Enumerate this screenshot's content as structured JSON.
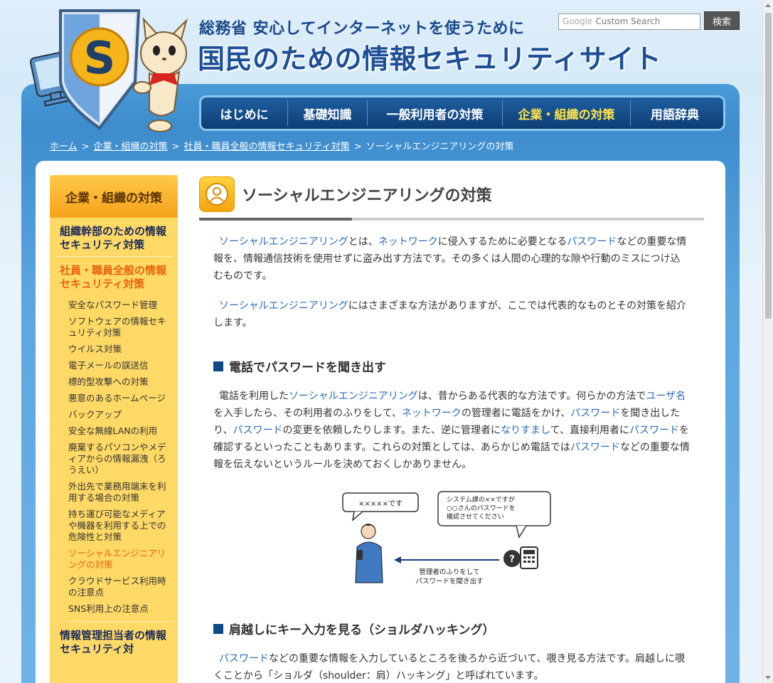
{
  "header": {
    "subtitle": "総務省 安心してインターネットを使うために",
    "title": "国民のための情報セキュリティサイト"
  },
  "search": {
    "brand": "Google",
    "placeholder": "Custom Search",
    "button_label": "検索"
  },
  "gnav": {
    "items": [
      {
        "label": "はじめに"
      },
      {
        "label": "基礎知識"
      },
      {
        "label": "一般利用者の対策"
      },
      {
        "label": "企業・組織の対策"
      },
      {
        "label": "用語辞典"
      }
    ]
  },
  "breadcrumb": {
    "items": [
      "ホーム",
      "企業・組織の対策",
      "社員・職員全般の情報セキュリティ対策"
    ],
    "current": "ソーシャルエンジニアリングの対策",
    "separator": ">"
  },
  "sidebar": {
    "heading": "企業・組織の対策",
    "section1": "組織幹部のための情報セキュリティ対策",
    "section2": "社員・職員全般の情報セキュリティ対策",
    "items": [
      "安全なパスワード管理",
      "ソフトウェアの情報セキュリティ対策",
      "ウイルス対策",
      "電子メールの誤送信",
      "標的型攻撃への対策",
      "悪意のあるホームページ",
      "バックアップ",
      "安全な無線LANの利用",
      "廃棄するパソコンやメディアからの情報漏洩（ろうえい）",
      "外出先で業務用端末を利用する場合の対策",
      "持ち運び可能なメディアや機器を利用する上での危険性と対策",
      "ソーシャルエンジニアリングの対策",
      "クラウドサービス利用時の注意点",
      "SNS利用上の注意点"
    ],
    "section3": "情報管理担当者の情報セキュリティ対"
  },
  "main": {
    "heading": "ソーシャルエンジニアリングの対策",
    "p1": {
      "l1": "ソーシャルエンジニアリング",
      "t1": "とは、",
      "l2": "ネットワーク",
      "t2": "に侵入するために必要となる",
      "l3": "パスワード",
      "t3": "などの重要な情報を、情報通信技術を使用せずに盗み出す方法です。その多くは人間の心理的な隙や行動のミスにつけ込むものです。"
    },
    "p2": {
      "l1": "ソーシャルエンジニアリング",
      "t1": "にはさまざまな方法がありますが、ここでは代表的なものとその対策を紹介します。"
    },
    "h2a": "電話でパスワードを聞き出す",
    "p3": {
      "t0": "電話を利用した",
      "l1": "ソーシャルエンジニアリング",
      "t1": "は、昔からある代表的な方法です。何らかの方法で",
      "l2": "ユーザ名",
      "t2": "を入手したら、その利用者のふりをして、",
      "l3": "ネットワーク",
      "t3": "の管理者に電話をかけ、",
      "l4": "パスワード",
      "t4": "を聞き出したり、",
      "l5": "パスワード",
      "t5": "の変更を依頼したりします。また、逆に管理者に",
      "l6": "なりすまし",
      "t6": "て、直接利用者に",
      "l7": "パスワード",
      "t7": "を確認するといったこともあります。これらの対策としては、あらかじめ電話では",
      "l8": "パスワード",
      "t8": "などの重要な情報を伝えないというルールを決めておくしかありません。"
    },
    "illust": {
      "bubble_left": "×××××です",
      "bubble_right_1": "システム課の××ですが",
      "bubble_right_2": "○○さんのパスワードを",
      "bubble_right_3": "確認させてください",
      "caption_1": "管理者のふりをして",
      "caption_2": "パスワードを聞き出す"
    },
    "h2b": "肩越しにキー入力を見る（ショルダハッキング）",
    "p4": {
      "l1": "パスワード",
      "t1": "などの重要な情報を入力しているところを後ろから近づいて、覗き見る方法です。肩越しに覗くことから「ショルダ（shoulder：肩）ハッキング」と呼ばれています。"
    }
  },
  "colors": {
    "nav_bg": "#0d3d75",
    "nav_active": "#ffe44a",
    "sidebar_bg": "#ffd966",
    "sidebar_active": "#e8620a",
    "link": "#2a6bb8"
  }
}
